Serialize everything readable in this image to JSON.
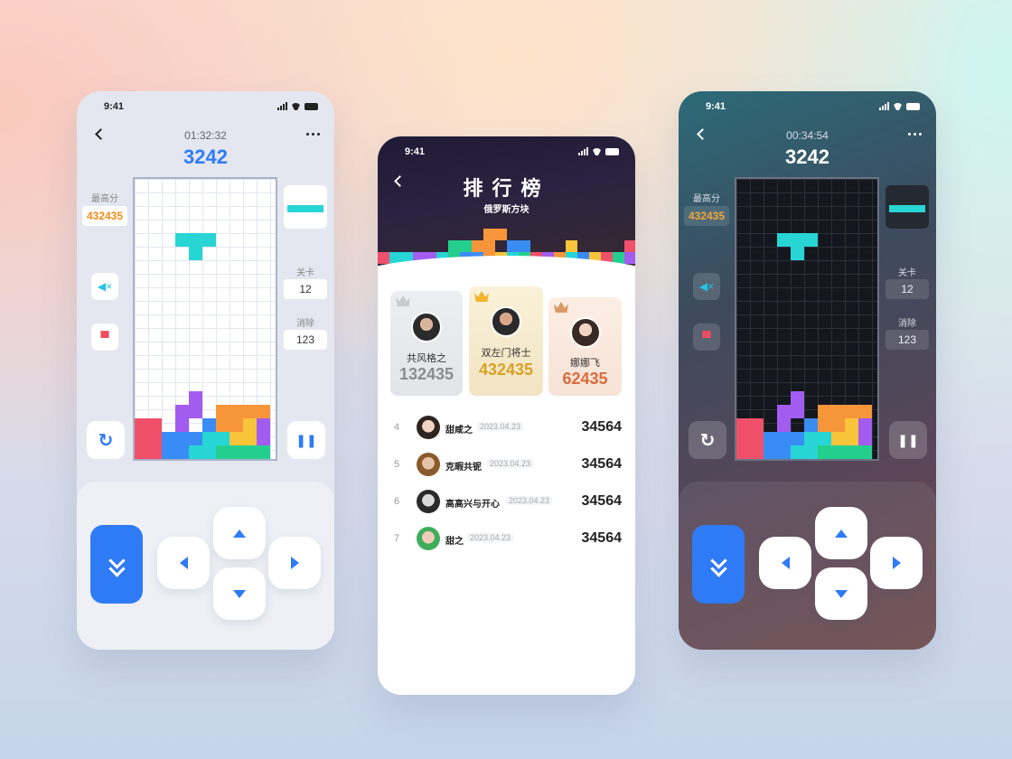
{
  "colors": {
    "accent": "#2f7bf6",
    "best_score": "#f28c1c",
    "tetromino_cyan": "#27d5d5",
    "gold": "#e5ae3a",
    "bronze": "#d96c3b",
    "silver": "#8c8c8c"
  },
  "light_game": {
    "status_time": "9:41",
    "timer": "01:32:32",
    "score": "3242",
    "best_label": "最高分",
    "best_value": "432435",
    "level_label": "关卡",
    "level_value": "12",
    "cleared_label": "消除",
    "cleared_value": "123",
    "icons": {
      "back": "back-chevron-icon",
      "more": "more-dots-icon",
      "mute": "mute-icon",
      "skin": "shirt-icon",
      "restart": "restart-icon",
      "pause": "pause-icon",
      "drop": "double-chevron-down-icon"
    }
  },
  "dark_game": {
    "status_time": "9:41",
    "timer": "00:34:54",
    "score": "3242",
    "best_label": "最高分",
    "best_value": "432435",
    "level_label": "关卡",
    "level_value": "12",
    "cleared_label": "消除",
    "cleared_value": "123"
  },
  "leaderboard": {
    "status_time": "9:41",
    "title": "排行榜",
    "subtitle": "俄罗斯方块",
    "podium": [
      {
        "rank": 2,
        "name": "共风格之",
        "score": "132435",
        "medal": "silver"
      },
      {
        "rank": 1,
        "name": "双左门将士",
        "score": "432435",
        "medal": "gold"
      },
      {
        "rank": 3,
        "name": "娜娜飞",
        "score": "62435",
        "medal": "bronze"
      }
    ],
    "rows": [
      {
        "rank": "4",
        "name": "甜咸之",
        "date": "2023.04.23",
        "score": "34564"
      },
      {
        "rank": "5",
        "name": "克暇共铌",
        "date": "2023.04.23",
        "score": "34564"
      },
      {
        "rank": "6",
        "name": "高高兴与开心",
        "date": "2023.04.23",
        "score": "34564"
      },
      {
        "rank": "7",
        "name": "甜之",
        "date": "2023.04.23",
        "score": "34564"
      }
    ]
  }
}
